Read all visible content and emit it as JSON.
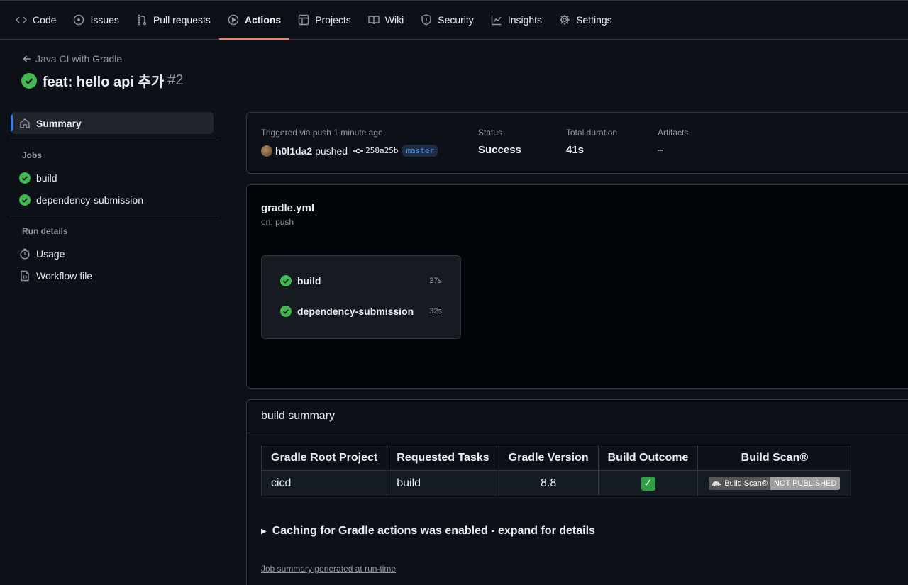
{
  "repo_nav": {
    "tabs": [
      {
        "label": "Code",
        "icon": "code-icon"
      },
      {
        "label": "Issues",
        "icon": "issue-icon"
      },
      {
        "label": "Pull requests",
        "icon": "pull-request-icon"
      },
      {
        "label": "Actions",
        "icon": "play-icon",
        "active": true
      },
      {
        "label": "Projects",
        "icon": "table-icon"
      },
      {
        "label": "Wiki",
        "icon": "book-icon"
      },
      {
        "label": "Security",
        "icon": "shield-icon"
      },
      {
        "label": "Insights",
        "icon": "graph-icon"
      },
      {
        "label": "Settings",
        "icon": "gear-icon"
      }
    ]
  },
  "header": {
    "back_label": "Java CI with Gradle",
    "run_title": "feat: hello api 추가",
    "run_number": "#2"
  },
  "sidebar": {
    "summary_label": "Summary",
    "jobs_heading": "Jobs",
    "jobs": [
      "build",
      "dependency-submission"
    ],
    "run_details_heading": "Run details",
    "usage_label": "Usage",
    "workflow_file_label": "Workflow file"
  },
  "run_meta": {
    "triggered_label": "Triggered via push 1 minute ago",
    "actor": "h0l1da2",
    "action": "pushed",
    "commit": "258a25b",
    "branch": "master",
    "status_label": "Status",
    "status_value": "Success",
    "duration_label": "Total duration",
    "duration_value": "41s",
    "artifacts_label": "Artifacts",
    "artifacts_value": "–"
  },
  "workflow_graph": {
    "file": "gradle.yml",
    "trigger": "on: push",
    "jobs": [
      {
        "name": "build",
        "duration": "27s"
      },
      {
        "name": "dependency-submission",
        "duration": "32s"
      }
    ]
  },
  "build_summary": {
    "heading": "build summary",
    "columns": [
      "Gradle Root Project",
      "Requested Tasks",
      "Gradle Version",
      "Build Outcome",
      "Build Scan®"
    ],
    "row": {
      "project": "cicd",
      "tasks": "build",
      "version": "8.8",
      "outcome_icon": "check-mark-button-icon",
      "scan_badge_left": "Build Scan®",
      "scan_badge_right": "NOT PUBLISHED"
    },
    "caching_toggle": "Caching for Gradle actions was enabled - expand for details",
    "generated_link": "Job summary generated at run-time"
  },
  "colors": {
    "accent_underline": "#f78166",
    "success_green": "#3fb950",
    "link_blue": "#4493f8"
  }
}
